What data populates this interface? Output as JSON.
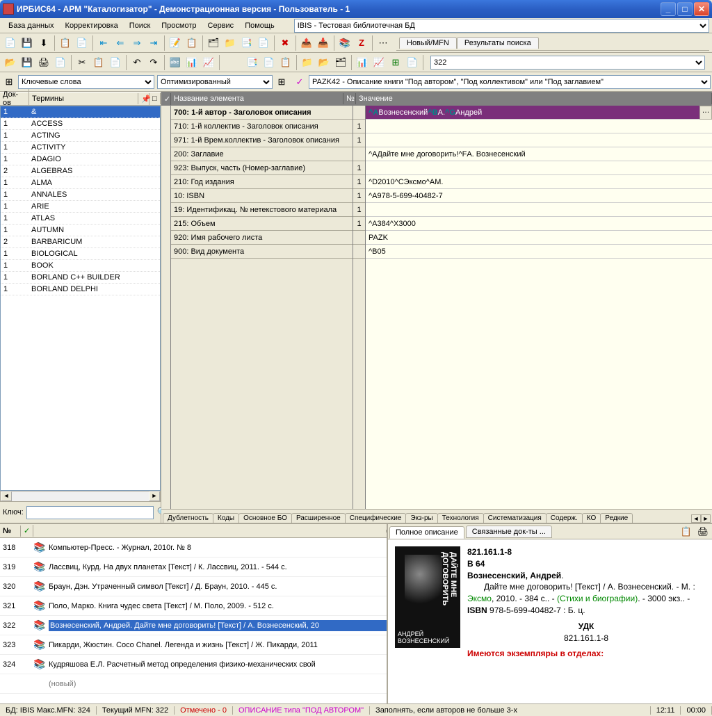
{
  "title": "ИРБИС64 - АРМ \"Каталогизатор\" - Демонстрационная версия - Пользователь - 1",
  "menu": [
    "База данных",
    "Корректировка",
    "Поиск",
    "Просмотр",
    "Сервис",
    "Помощь"
  ],
  "db_combo": "IBIS - Тестовая библиотечная БД",
  "top_tabs": [
    "Новый/MFN",
    "Результаты поиска"
  ],
  "mfn_input": "322",
  "left_combo": "Ключевые слова",
  "center_combo": "Оптимизированный",
  "right_combo": "PAZK42 - Описание книги \"Под автором\", \"Под коллективом\" или \"Под заглавием\"",
  "term_cols": {
    "c1": "Док-ов",
    "c2": "Термины"
  },
  "terms": [
    {
      "n": "1",
      "t": "&",
      "sel": true
    },
    {
      "n": "1",
      "t": "ACCESS"
    },
    {
      "n": "1",
      "t": "ACTING"
    },
    {
      "n": "1",
      "t": "ACTIVITY"
    },
    {
      "n": "1",
      "t": "ADAGIO"
    },
    {
      "n": "2",
      "t": "ALGEBRAS"
    },
    {
      "n": "1",
      "t": "ALMA"
    },
    {
      "n": "1",
      "t": "ANNALES"
    },
    {
      "n": "1",
      "t": "ARIE"
    },
    {
      "n": "1",
      "t": "ATLAS"
    },
    {
      "n": "1",
      "t": "AUTUMN"
    },
    {
      "n": "2",
      "t": "BARBARICUM"
    },
    {
      "n": "1",
      "t": "BIOLOGICAL"
    },
    {
      "n": "1",
      "t": "BOOK"
    },
    {
      "n": "1",
      "t": "BORLAND C++ BUILDER"
    },
    {
      "n": "1",
      "t": "BORLAND DELPHI"
    }
  ],
  "key_label": "Ключ:",
  "grid_headers": {
    "name": "Название элемента",
    "seq": "№",
    "val": "Значение"
  },
  "fields": [
    {
      "name": "700: 1-й  автор - Заголовок описания",
      "seq": "",
      "val": "^AВознесенский^BА.^GАндрей",
      "sel": true,
      "head": true
    },
    {
      "name": "710: 1-й коллектив - Заголовок описания",
      "seq": "1",
      "val": ""
    },
    {
      "name": "971: 1-й Врем.коллектив - Заголовок описания",
      "seq": "1",
      "val": ""
    },
    {
      "name": "200: Заглавие",
      "seq": "",
      "val": "^AДайте мне договорить!^FА. Вознесенский"
    },
    {
      "name": "923: Выпуск, часть (Номер-заглавие)",
      "seq": "1",
      "val": ""
    },
    {
      "name": "210: Год издания",
      "seq": "1",
      "val": "^D2010^CЭксмо^AМ."
    },
    {
      "name": "10: ISBN",
      "seq": "1",
      "val": "^A978-5-699-40482-7"
    },
    {
      "name": "19: Идентификац. № нетекстового материала",
      "seq": "1",
      "val": ""
    },
    {
      "name": "215: Объем",
      "seq": "1",
      "val": "^A384^X3000"
    },
    {
      "name": "920: Имя рабочего листа",
      "seq": "",
      "val": "PAZK"
    },
    {
      "name": "900: Вид документа",
      "seq": "",
      "val": "^B05"
    }
  ],
  "subtabs": [
    "Дублетность",
    "Коды",
    "Основное БО",
    "Расширенное",
    "Специфические",
    "Экз-ры",
    "Технология",
    "Систематизация",
    "Содерж.",
    "КО",
    "Редкие"
  ],
  "rec_cols": {
    "n": "№",
    "chk": "✓"
  },
  "records": [
    {
      "n": "318",
      "t": "Компьютер-Пресс. - Журнал, 2010г. № 8"
    },
    {
      "n": "319",
      "t": "Лассвиц, Курд. На двух планетах [Текст] / К. Лассвиц, 2011. - 544 с."
    },
    {
      "n": "320",
      "t": "Браун, Дэн. Утраченный символ [Текст] / Д. Браун, 2010. - 445 с."
    },
    {
      "n": "321",
      "t": "Поло, Марко. Книга чудес света [Текст] / М. Поло, 2009. - 512 с."
    },
    {
      "n": "322",
      "t": "Вознесенский, Андрей. Дайте мне договорить! [Текст] / А. Вознесенский, 20",
      "sel": true
    },
    {
      "n": "323",
      "t": "Пикарди, Жюстин. Coco Chanel. Легенда и жизнь [Текст] / Ж. Пикарди, 2011"
    },
    {
      "n": "324",
      "t": "Кудряшова Е.Л. Расчетный метод определения физико-механических свой"
    },
    {
      "n": "",
      "t": "(новый)",
      "new": true
    }
  ],
  "desc_tabs": [
    "Полное описание",
    "Связанные док-ты ..."
  ],
  "cover": {
    "author": "АНДРЕЙ ВОЗНЕСЕНСКИЙ",
    "title": "ДАЙТЕ МНЕ ДОГОВОРИТЬ"
  },
  "desc": {
    "class1": "821.161.1-8",
    "class2": "В 64",
    "author": "Вознесенский, Андрей",
    "title": "Дайте мне договорить! [Текст] / А. Вознесенский",
    "place": "М.",
    "publisher": "Эксмо",
    "year": "2010",
    "pages": "384 с.",
    "series": "(Стихи и биографии)",
    "copies": "3000 экз.",
    "isbn_lbl": "ISBN",
    "isbn": "978-5-699-40482-7",
    "price": "Б. ц.",
    "udk_lbl": "УДК",
    "udk": "821.161.1-8",
    "holdings": "Имеются экземпляры в отделах:"
  },
  "status": {
    "db": "БД: IBIS Макс.MFN: 324",
    "cur": "Текущий MFN: 322",
    "marked": "Отмечено - 0",
    "msg": "ОПИСАНИЕ типа \"ПОД АВТОРОМ\"",
    "hint": "Заполнять, если авторов не больше 3-х",
    "time": "12:11",
    "cap": "00:00"
  }
}
